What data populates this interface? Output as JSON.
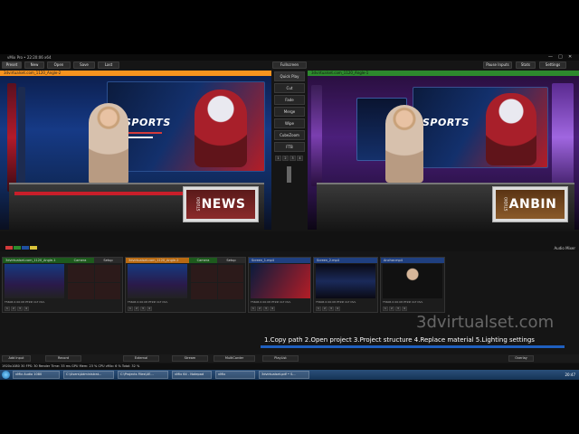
{
  "window": {
    "title": "vMix Pro • 22:20:06 x64"
  },
  "toolbar": {
    "preset": "Preset",
    "new": "New",
    "open": "Open",
    "save": "Save",
    "last": "Last",
    "fullscreen": "Fullscreen",
    "pause_inputs": "Pause Inputs",
    "stats": "Stats",
    "settings": "Settings"
  },
  "preview": {
    "label": "3dvirtualset.com_1120_Angle-2"
  },
  "output": {
    "label": "3dvirtualset.com_1120_Angle-1"
  },
  "transitions": {
    "quick_play": "Quick Play",
    "cut": "Cut",
    "fade": "Fade",
    "merge": "Merge",
    "wipe": "Wipe",
    "cube_zoom": "CubeZoom",
    "ftb": "FTB",
    "numbers": [
      "1",
      "2",
      "3",
      "4"
    ]
  },
  "scene_left": {
    "sports": "SPORTS",
    "desk_text": "NEWS",
    "desk_small": "STUDIO"
  },
  "scene_right": {
    "sports": "SPORTS",
    "desk_text": "ANBIN",
    "desk_small": "STUDIO"
  },
  "audio": {
    "label": "Audio Mixer"
  },
  "tiles": [
    {
      "title": "3dvirtualset.com_1120_Angle-1",
      "info": "T5606  0:00:08  PTZ#  CLT  OVL",
      "side_a": "Camera",
      "side_b": "Setup",
      "color": "#2d8a2d"
    },
    {
      "title": "3dvirtualset.com_1120_Angle-2",
      "info": "T5606  0:00:08  PTZ#  CLT  OVL",
      "side_a": "Camera",
      "side_b": "Setup",
      "color": "#f7931e"
    },
    {
      "title": "Screen_1.mp4",
      "info": "T5606  0:00:08  PTZ#  CLT  OVL",
      "color": "#1f4f9f"
    },
    {
      "title": "Screen_2.mp4",
      "info": "T5606  0:00:08  PTZ#  CLT  OVL",
      "color": "#1f4f9f"
    },
    {
      "title": "Anchor.mp4",
      "info": "T5606  0:00:08  PTZ#  CLT  OVL",
      "color": "#1f4f9f"
    }
  ],
  "tile_controls": [
    "1",
    "2",
    "3",
    "4"
  ],
  "watermark": "3dvirtualset.com",
  "steps": {
    "text": "1.Copy path          2.Open project          3.Project structure     4.Replace material     5.Lighting settings"
  },
  "bottom": {
    "add_input": "Add Input",
    "record": "Record",
    "external": "External",
    "stream": "Stream",
    "multicorder": "MultiCorder",
    "playlist": "PlayList",
    "overlay": "Overlay"
  },
  "status": {
    "text": "1920x1080  30 FPS: 30  Render Time: 33 ms  GPU Mem: 23 %  CPU vMix: 6 %  Total: 32 %"
  },
  "taskbar": {
    "items": [
      "vMix Audio 1080",
      "C:\\Users\\Administrat...",
      "C:\\Projects Files\\UE...",
      "vMix 64 - Notepad",
      "vMix",
      "3dvirtualset.pdf • S..."
    ],
    "clock": "20:47"
  },
  "colors": {
    "preview": "#f7931e",
    "output": "#2d8a2d",
    "accent": "#1f5fbf"
  },
  "chips": [
    "#d33b3b",
    "#2d8a2d",
    "#1f4f9f",
    "#d8c23a"
  ]
}
